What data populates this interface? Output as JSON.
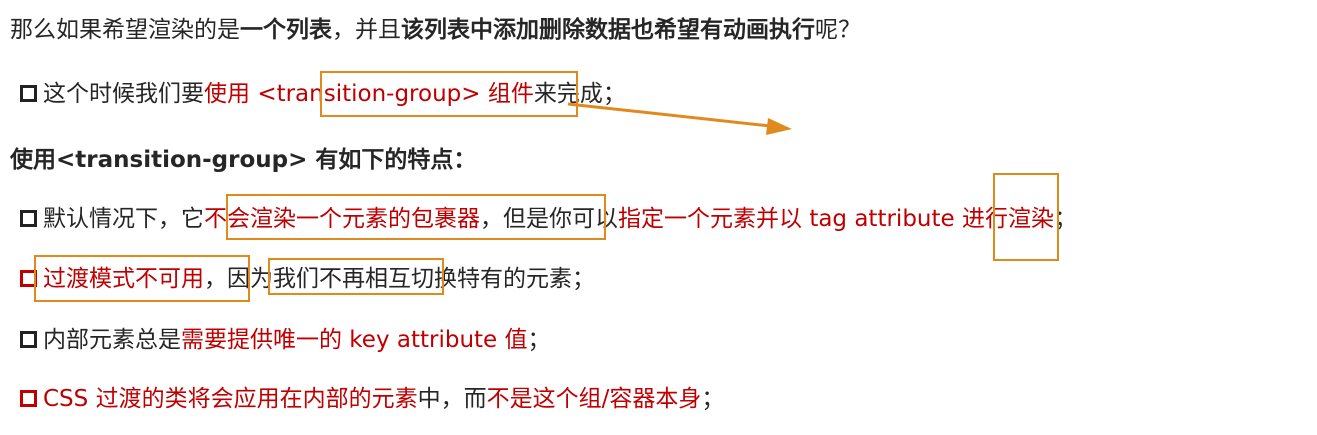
{
  "intro": {
    "p1": "那么如果希望渲染的是",
    "p2": "一个列表",
    "p3": "，并且",
    "p4": "该列表中添加删除数据也希望有动画执行",
    "p5": "呢？"
  },
  "bullet1": {
    "p1": "这个时候我们要",
    "p2": "使用 ",
    "p3": "<transition-group>",
    "p4": " 组件",
    "p5": "来完成；"
  },
  "features_heading": "使用<transition-group> 有如下的特点：",
  "features": {
    "f1": {
      "p1": "默认情况下，它",
      "p2": "不会渲染一个元素的包裹器",
      "p3": "，但是你可以",
      "p4": "指定一个元素并以 ",
      "p5": "tag",
      "p6": " attribute 进行渲染",
      "p7": "；"
    },
    "f2": {
      "p1": "过渡模式不可用",
      "p2": "，因为我们不再相互切换特有的元素；"
    },
    "f3": {
      "p1": "内部元素总是",
      "p2": "需要提供唯一的 key attribute 值",
      "p3": "；"
    },
    "f4": {
      "p1": "CSS 过渡的类将会应用在内部的元素",
      "p2": "中，而",
      "p3": "不是这个组/容器本身",
      "p4": "；"
    }
  },
  "colors": {
    "accent_red": "#c00000",
    "highlight_orange": "#e08a1e",
    "text": "#262626"
  }
}
